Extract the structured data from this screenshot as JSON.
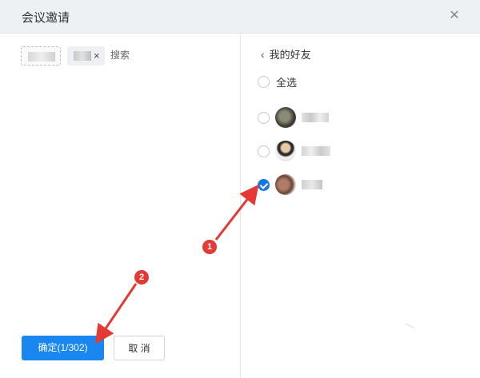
{
  "window": {
    "title": "会议邀请"
  },
  "selected_chips": [
    {
      "name": ""
    },
    {
      "name": "",
      "remove_label": "×"
    }
  ],
  "search": {
    "placeholder": "搜索"
  },
  "friends_panel": {
    "back_icon": "chevron-left-icon",
    "heading": "我的好友",
    "select_all_label": "全选",
    "friends": [
      {
        "name": "",
        "checked": false
      },
      {
        "name": "",
        "checked": false
      },
      {
        "name": "",
        "checked": true
      }
    ]
  },
  "footer": {
    "confirm_label": "确定(1/302)",
    "cancel_label": "取 消"
  },
  "annotations": [
    {
      "label": "1"
    },
    {
      "label": "2"
    }
  ],
  "colors": {
    "accent": "#1a86f0",
    "annotation": "#e53935"
  }
}
